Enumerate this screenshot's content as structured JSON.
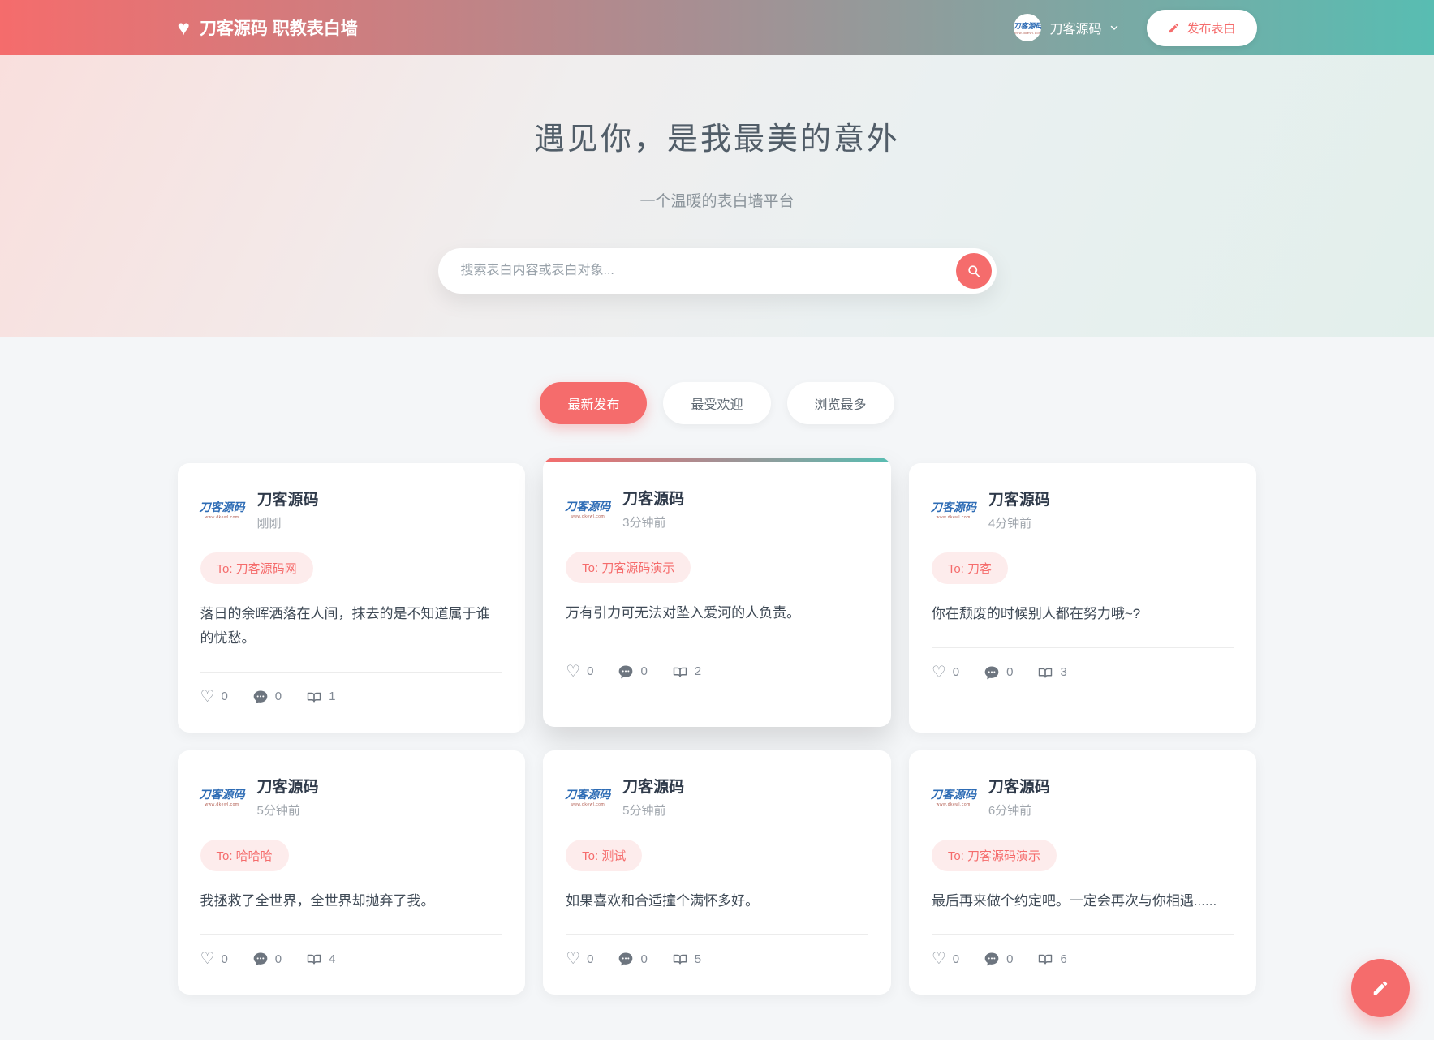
{
  "navbar": {
    "brand": "刀客源码 职教表白墙",
    "brand_icon": "heart-icon",
    "user_name": "刀客源码",
    "publish_label": "发布表白"
  },
  "logo": {
    "line1": "刀客源码",
    "line2": "www.dkewl.com"
  },
  "hero": {
    "title": "遇见你，是我最美的意外",
    "subtitle": "一个温暖的表白墙平台",
    "search_placeholder": "搜索表白内容或表白对象..."
  },
  "tabs": [
    {
      "label": "最新发布",
      "active": true
    },
    {
      "label": "最受欢迎",
      "active": false
    },
    {
      "label": "浏览最多",
      "active": false
    }
  ],
  "cards": [
    {
      "author": "刀客源码",
      "time": "刚刚",
      "to": "To: 刀客源码网",
      "content": "落日的余晖洒落在人间，抹去的是不知道属于谁的忧愁。",
      "likes": "0",
      "comments": "0",
      "views": "1",
      "featured": false
    },
    {
      "author": "刀客源码",
      "time": "3分钟前",
      "to": "To: 刀客源码演示",
      "content": "万有引力可无法对坠入爱河的人负责。",
      "likes": "0",
      "comments": "0",
      "views": "2",
      "featured": true
    },
    {
      "author": "刀客源码",
      "time": "4分钟前",
      "to": "To: 刀客",
      "content": "你在颓废的时候别人都在努力哦~?",
      "likes": "0",
      "comments": "0",
      "views": "3",
      "featured": false
    },
    {
      "author": "刀客源码",
      "time": "5分钟前",
      "to": "To: 哈哈哈",
      "content": "我拯救了全世界，全世界却抛弃了我。",
      "likes": "0",
      "comments": "0",
      "views": "4",
      "featured": false
    },
    {
      "author": "刀客源码",
      "time": "5分钟前",
      "to": "To: 测试",
      "content": "如果喜欢和合适撞个满怀多好。",
      "likes": "0",
      "comments": "0",
      "views": "5",
      "featured": false
    },
    {
      "author": "刀客源码",
      "time": "6分钟前",
      "to": "To: 刀客源码演示",
      "content": "最后再来做个约定吧。一定会再次与你相遇......",
      "likes": "0",
      "comments": "0",
      "views": "6",
      "featured": false
    }
  ],
  "icons": {
    "brand": "heart",
    "search": "magnifier",
    "publish": "pencil",
    "chevron": "chevron-down",
    "like": "heart-outline",
    "comment": "speech-bubble",
    "views": "open-book",
    "fab": "pencil"
  },
  "colors": {
    "accent": "#f56c6c",
    "teal": "#58bdb2",
    "badge_bg": "#fdecec",
    "page_bg": "#f4f6f8"
  }
}
